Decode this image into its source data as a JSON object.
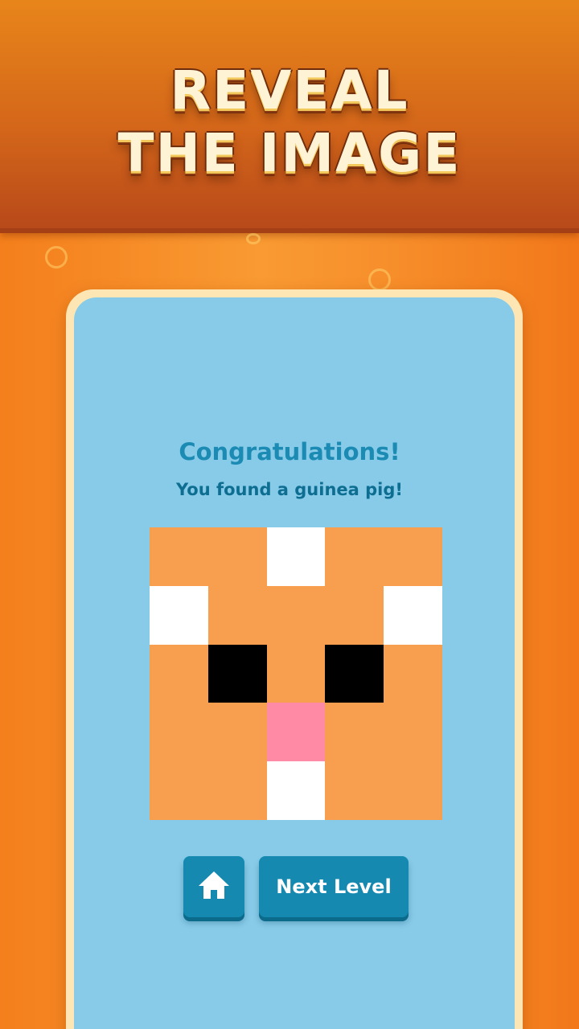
{
  "header": {
    "title_line1": "REVEAL",
    "title_line2": "THE IMAGE"
  },
  "result": {
    "heading": "Congratulations!",
    "message": "You found a guinea pig!"
  },
  "pixel_art": {
    "palette": {
      "O": "#f89e4f",
      "W": "#ffffff",
      "B": "#000000",
      "P": "#fe8aa5"
    },
    "rows": [
      [
        "O",
        "O",
        "W",
        "O",
        "O"
      ],
      [
        "W",
        "O",
        "O",
        "O",
        "W"
      ],
      [
        "O",
        "B",
        "O",
        "B",
        "O"
      ],
      [
        "O",
        "O",
        "P",
        "O",
        "O"
      ],
      [
        "O",
        "O",
        "W",
        "O",
        "O"
      ]
    ]
  },
  "buttons": {
    "home_icon": "home-icon",
    "next_label": "Next Level"
  },
  "colors": {
    "button_blue": "#1589b0",
    "card_blue": "#87cbe9",
    "header_orange": "#d4671a"
  }
}
